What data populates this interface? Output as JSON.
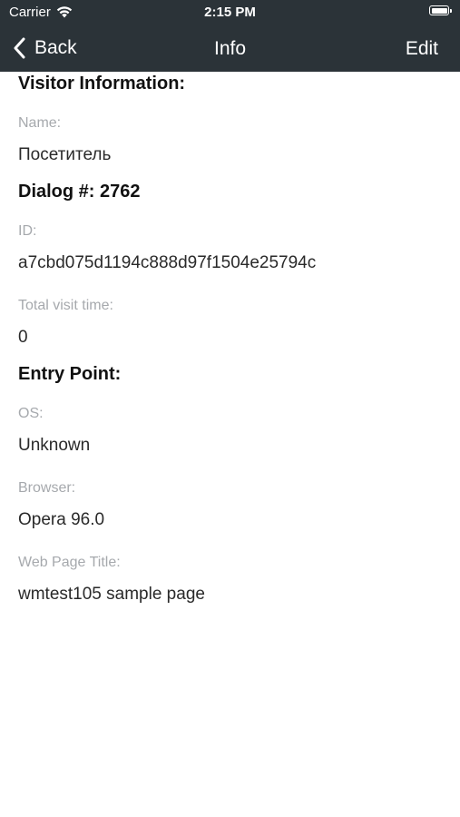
{
  "status_bar": {
    "carrier": "Carrier",
    "time": "2:15 PM",
    "icons": [
      "wifi-icon",
      "battery-icon"
    ]
  },
  "navbar": {
    "back_label": "Back",
    "title": "Info",
    "edit_label": "Edit",
    "background": "#2b3338"
  },
  "visitor": {
    "section_title": "Visitor Information:",
    "name_label": "Name:",
    "name_value": "Посетитель"
  },
  "dialog": {
    "section_title": "Dialog #: 2762",
    "id_label": "ID:",
    "id_value": "a7cbd075d1194c888d97f1504e25794c",
    "visit_time_label": "Total visit time:",
    "visit_time_value": "0"
  },
  "entry_point": {
    "section_title": "Entry Point:",
    "os_label": "OS:",
    "os_value": "Unknown",
    "browser_label": "Browser:",
    "browser_value": "Opera 96.0",
    "page_title_label": "Web Page Title:",
    "page_title_value": "wmtest105 sample page"
  }
}
